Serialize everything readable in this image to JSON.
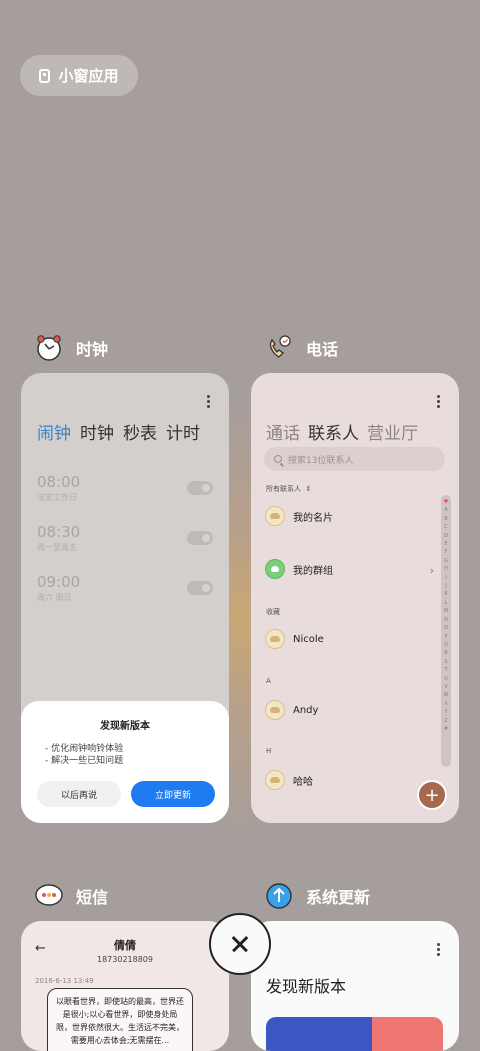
{
  "floating_windows": {
    "label": "小窗应用",
    "icon": "floating-window-icon"
  },
  "apps": {
    "clock": {
      "name": "时钟",
      "icon": "alarm-clock-icon",
      "tabs": [
        "闹钟",
        "时钟",
        "秒表",
        "计时"
      ],
      "active_tab": "闹钟",
      "alarms": [
        {
          "time": "08:00",
          "repeat": "法定工作日",
          "enabled": false
        },
        {
          "time": "08:30",
          "repeat": "周一至周五",
          "enabled": false
        },
        {
          "time": "09:00",
          "repeat": "周六 周日",
          "enabled": false
        }
      ],
      "dialog": {
        "title": "发现新版本",
        "lines": [
          "- 优化闹钟响铃体验",
          "- 解决一些已知问题"
        ],
        "later": "以后再说",
        "update_now": "立即更新"
      }
    },
    "phone": {
      "name": "电话",
      "icon": "phone-icon",
      "tabs": [
        "通话",
        "联系人",
        "营业厅"
      ],
      "active_tab": "联系人",
      "search_placeholder": "搜索13位联系人",
      "all_contacts_label": "所有联系人",
      "my_card": "我的名片",
      "my_groups": "我的群组",
      "favorites_label": "收藏",
      "sections": [
        {
          "header": "",
          "name": "Nicole"
        },
        {
          "header": "A",
          "name": "Andy"
        },
        {
          "header": "H",
          "name": "哈哈"
        }
      ],
      "index_letters": [
        "A",
        "B",
        "C",
        "D",
        "E",
        "F",
        "G",
        "H",
        "I",
        "J",
        "K",
        "L",
        "M",
        "N",
        "O",
        "P",
        "Q",
        "R",
        "S",
        "T",
        "U",
        "V",
        "W",
        "X",
        "Y",
        "Z",
        "#"
      ],
      "add_button": "+"
    },
    "sms": {
      "name": "短信",
      "icon": "messages-icon",
      "contact_name": "倩倩",
      "contact_number": "18730218809",
      "date": "2016-6-13 13:49",
      "message": "以眼看世界，即使站的最高，世界还是很小;以心看世界，即使身处局限，世界依然很大。生活远不完美，需要用心去体会;无需摆在..."
    },
    "update": {
      "name": "系统更新",
      "icon": "system-update-icon",
      "title": "发现新版本"
    }
  },
  "close_button": "close-icon"
}
